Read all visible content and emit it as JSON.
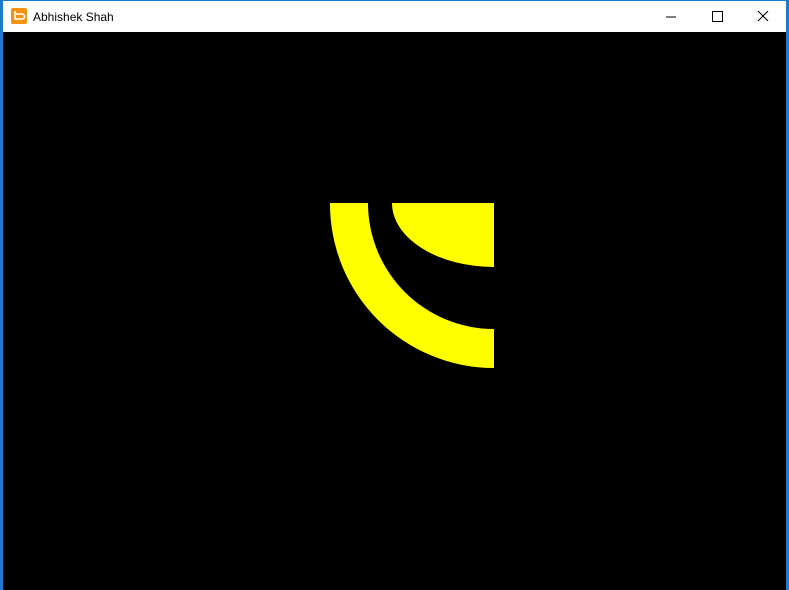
{
  "window": {
    "title": "Abhishek Shah",
    "app_icon": "app-icon",
    "buttons": [
      "minimize-icon",
      "maximize-icon",
      "close-icon"
    ]
  },
  "canvas": {
    "background": "#000000",
    "shape_color": "#ffff00"
  }
}
